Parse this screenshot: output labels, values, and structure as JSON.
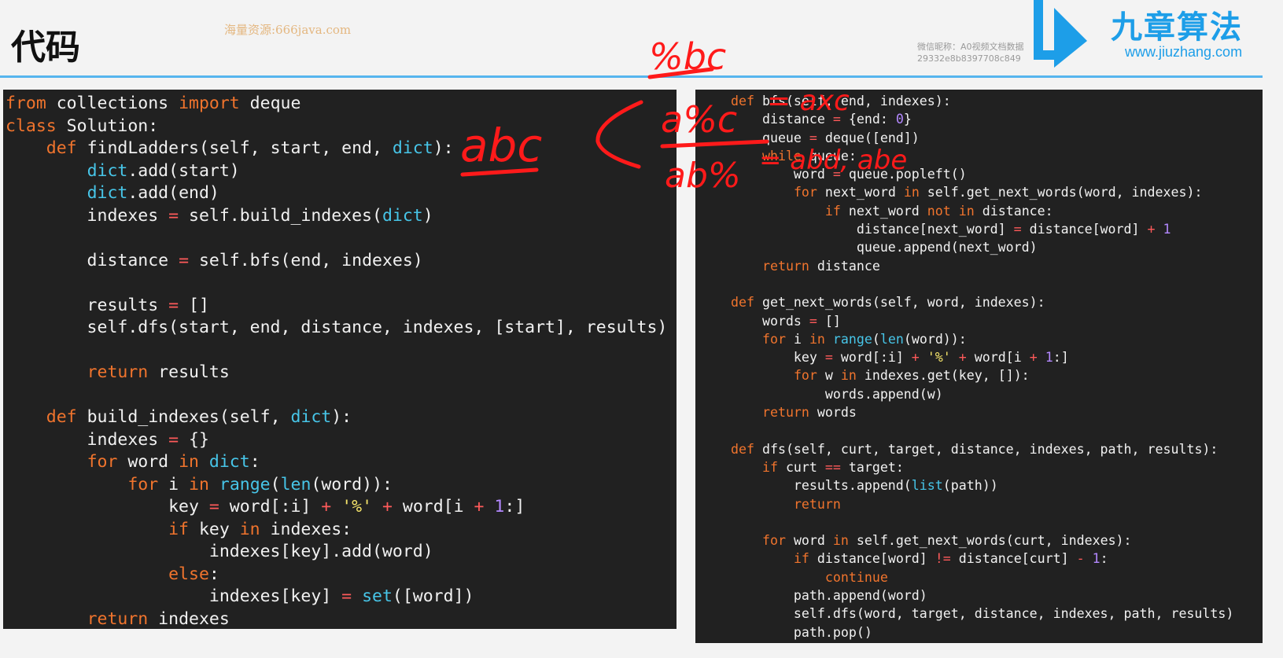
{
  "header": {
    "title": "代码",
    "watermark": "海量资源:666java.com",
    "wechat_line1": "微信昵称：A0视频文档数据",
    "wechat_line2": "29332e8b8397708c849",
    "brand_name": "九章算法",
    "brand_url": "www.jiuzhang.com",
    "accent_color": "#56b5ee",
    "brand_color": "#1d9ee8"
  },
  "annotations": {
    "abc_left": "abc",
    "pct_bc": "%bc",
    "a_pct_c": "a%c",
    "ab_pct": "ab%",
    "eq1": "= axc",
    "eq2": "= abd, abe",
    "ink_color": "#ff1a1a"
  },
  "code_left": [
    [
      [
        "kw",
        "from"
      ],
      [
        "t",
        " collections "
      ],
      [
        "kw",
        "import"
      ],
      [
        "t",
        " deque"
      ]
    ],
    [
      [
        "kw",
        "class"
      ],
      [
        "t",
        " Solution:"
      ]
    ],
    [
      [
        "t",
        "    "
      ],
      [
        "kw",
        "def"
      ],
      [
        "t",
        " findLadders(self, start, end, "
      ],
      [
        "bi",
        "dict"
      ],
      [
        "t",
        "):"
      ]
    ],
    [
      [
        "t",
        "        "
      ],
      [
        "bi",
        "dict"
      ],
      [
        "t",
        ".add(start)"
      ]
    ],
    [
      [
        "t",
        "        "
      ],
      [
        "bi",
        "dict"
      ],
      [
        "t",
        ".add(end)"
      ]
    ],
    [
      [
        "t",
        "        indexes "
      ],
      [
        "op",
        "="
      ],
      [
        "t",
        " self.build_indexes("
      ],
      [
        "bi",
        "dict"
      ],
      [
        "t",
        ")"
      ]
    ],
    [
      [
        "t",
        ""
      ]
    ],
    [
      [
        "t",
        "        distance "
      ],
      [
        "op",
        "="
      ],
      [
        "t",
        " self.bfs(end, indexes)"
      ]
    ],
    [
      [
        "t",
        ""
      ]
    ],
    [
      [
        "t",
        "        results "
      ],
      [
        "op",
        "="
      ],
      [
        "t",
        " []"
      ]
    ],
    [
      [
        "t",
        "        self.dfs(start, end, distance, indexes, [start], results)"
      ]
    ],
    [
      [
        "t",
        ""
      ]
    ],
    [
      [
        "t",
        "        "
      ],
      [
        "kw",
        "return"
      ],
      [
        "t",
        " results"
      ]
    ],
    [
      [
        "t",
        ""
      ]
    ],
    [
      [
        "t",
        "    "
      ],
      [
        "kw",
        "def"
      ],
      [
        "t",
        " build_indexes(self, "
      ],
      [
        "bi",
        "dict"
      ],
      [
        "t",
        "):"
      ]
    ],
    [
      [
        "t",
        "        indexes "
      ],
      [
        "op",
        "="
      ],
      [
        "t",
        " {}"
      ]
    ],
    [
      [
        "t",
        "        "
      ],
      [
        "kw",
        "for"
      ],
      [
        "t",
        " word "
      ],
      [
        "kw",
        "in"
      ],
      [
        "t",
        " "
      ],
      [
        "bi",
        "dict"
      ],
      [
        "t",
        ":"
      ]
    ],
    [
      [
        "t",
        "            "
      ],
      [
        "kw",
        "for"
      ],
      [
        "t",
        " i "
      ],
      [
        "kw",
        "in"
      ],
      [
        "t",
        " "
      ],
      [
        "bi",
        "range"
      ],
      [
        "t",
        "("
      ],
      [
        "bi",
        "len"
      ],
      [
        "t",
        "(word)):"
      ]
    ],
    [
      [
        "t",
        "                key "
      ],
      [
        "op",
        "="
      ],
      [
        "t",
        " word[:i] "
      ],
      [
        "op",
        "+"
      ],
      [
        "t",
        " "
      ],
      [
        "str",
        "'%'"
      ],
      [
        "t",
        " "
      ],
      [
        "op",
        "+"
      ],
      [
        "t",
        " word[i "
      ],
      [
        "op",
        "+"
      ],
      [
        "t",
        " "
      ],
      [
        "num",
        "1"
      ],
      [
        "t",
        ":]"
      ]
    ],
    [
      [
        "t",
        "                "
      ],
      [
        "kw",
        "if"
      ],
      [
        "t",
        " key "
      ],
      [
        "kw",
        "in"
      ],
      [
        "t",
        " indexes:"
      ]
    ],
    [
      [
        "t",
        "                    indexes[key].add(word)"
      ]
    ],
    [
      [
        "t",
        "                "
      ],
      [
        "kw",
        "else"
      ],
      [
        "t",
        ":"
      ]
    ],
    [
      [
        "t",
        "                    indexes[key] "
      ],
      [
        "op",
        "="
      ],
      [
        "t",
        " "
      ],
      [
        "bi",
        "set"
      ],
      [
        "t",
        "([word])"
      ]
    ],
    [
      [
        "t",
        "        "
      ],
      [
        "kw",
        "return"
      ],
      [
        "t",
        " indexes"
      ]
    ]
  ],
  "code_right": [
    [
      [
        "kw",
        "def"
      ],
      [
        "t",
        " bfs(self, end, indexes):"
      ]
    ],
    [
      [
        "t",
        "    distance "
      ],
      [
        "op",
        "="
      ],
      [
        "t",
        " {end: "
      ],
      [
        "num",
        "0"
      ],
      [
        "t",
        "}"
      ]
    ],
    [
      [
        "t",
        "    queue "
      ],
      [
        "op",
        "="
      ],
      [
        "t",
        " deque([end])"
      ]
    ],
    [
      [
        "t",
        "    "
      ],
      [
        "kw",
        "while"
      ],
      [
        "t",
        " queue:"
      ]
    ],
    [
      [
        "t",
        "        word "
      ],
      [
        "op",
        "="
      ],
      [
        "t",
        " queue.popleft()"
      ]
    ],
    [
      [
        "t",
        "        "
      ],
      [
        "kw",
        "for"
      ],
      [
        "t",
        " next_word "
      ],
      [
        "kw",
        "in"
      ],
      [
        "t",
        " self.get_next_words(word, indexes):"
      ]
    ],
    [
      [
        "t",
        "            "
      ],
      [
        "kw",
        "if"
      ],
      [
        "t",
        " next_word "
      ],
      [
        "kw",
        "not"
      ],
      [
        "t",
        " "
      ],
      [
        "kw",
        "in"
      ],
      [
        "t",
        " distance:"
      ]
    ],
    [
      [
        "t",
        "                distance[next_word] "
      ],
      [
        "op",
        "="
      ],
      [
        "t",
        " distance[word] "
      ],
      [
        "op",
        "+"
      ],
      [
        "t",
        " "
      ],
      [
        "num",
        "1"
      ]
    ],
    [
      [
        "t",
        "                queue.append(next_word)"
      ]
    ],
    [
      [
        "t",
        "    "
      ],
      [
        "kw",
        "return"
      ],
      [
        "t",
        " distance"
      ]
    ],
    [
      [
        "t",
        ""
      ]
    ],
    [
      [
        "kw",
        "def"
      ],
      [
        "t",
        " get_next_words(self, word, indexes):"
      ]
    ],
    [
      [
        "t",
        "    words "
      ],
      [
        "op",
        "="
      ],
      [
        "t",
        " []"
      ]
    ],
    [
      [
        "t",
        "    "
      ],
      [
        "kw",
        "for"
      ],
      [
        "t",
        " i "
      ],
      [
        "kw",
        "in"
      ],
      [
        "t",
        " "
      ],
      [
        "bi",
        "range"
      ],
      [
        "t",
        "("
      ],
      [
        "bi",
        "len"
      ],
      [
        "t",
        "(word)):"
      ]
    ],
    [
      [
        "t",
        "        key "
      ],
      [
        "op",
        "="
      ],
      [
        "t",
        " word[:i] "
      ],
      [
        "op",
        "+"
      ],
      [
        "t",
        " "
      ],
      [
        "str",
        "'%'"
      ],
      [
        "t",
        " "
      ],
      [
        "op",
        "+"
      ],
      [
        "t",
        " word[i "
      ],
      [
        "op",
        "+"
      ],
      [
        "t",
        " "
      ],
      [
        "num",
        "1"
      ],
      [
        "t",
        ":]"
      ]
    ],
    [
      [
        "t",
        "        "
      ],
      [
        "kw",
        "for"
      ],
      [
        "t",
        " w "
      ],
      [
        "kw",
        "in"
      ],
      [
        "t",
        " indexes.get(key, []):"
      ]
    ],
    [
      [
        "t",
        "            words.append(w)"
      ]
    ],
    [
      [
        "t",
        "    "
      ],
      [
        "kw",
        "return"
      ],
      [
        "t",
        " words"
      ]
    ],
    [
      [
        "t",
        ""
      ]
    ],
    [
      [
        "kw",
        "def"
      ],
      [
        "t",
        " dfs(self, curt, target, distance, indexes, path, results):"
      ]
    ],
    [
      [
        "t",
        "    "
      ],
      [
        "kw",
        "if"
      ],
      [
        "t",
        " curt "
      ],
      [
        "op",
        "=="
      ],
      [
        "t",
        " target:"
      ]
    ],
    [
      [
        "t",
        "        results.append("
      ],
      [
        "bi",
        "list"
      ],
      [
        "t",
        "(path))"
      ]
    ],
    [
      [
        "t",
        "        "
      ],
      [
        "kw",
        "return"
      ]
    ],
    [
      [
        "t",
        ""
      ]
    ],
    [
      [
        "t",
        "    "
      ],
      [
        "kw",
        "for"
      ],
      [
        "t",
        " word "
      ],
      [
        "kw",
        "in"
      ],
      [
        "t",
        " self.get_next_words(curt, indexes):"
      ]
    ],
    [
      [
        "t",
        "        "
      ],
      [
        "kw",
        "if"
      ],
      [
        "t",
        " distance[word] "
      ],
      [
        "op",
        "!="
      ],
      [
        "t",
        " distance[curt] "
      ],
      [
        "op",
        "-"
      ],
      [
        "t",
        " "
      ],
      [
        "num",
        "1"
      ],
      [
        "t",
        ":"
      ]
    ],
    [
      [
        "t",
        "            "
      ],
      [
        "kw",
        "continue"
      ]
    ],
    [
      [
        "t",
        "        path.append(word)"
      ]
    ],
    [
      [
        "t",
        "        self.dfs(word, target, distance, indexes, path, results)"
      ]
    ],
    [
      [
        "t",
        "        path.pop()"
      ]
    ]
  ]
}
